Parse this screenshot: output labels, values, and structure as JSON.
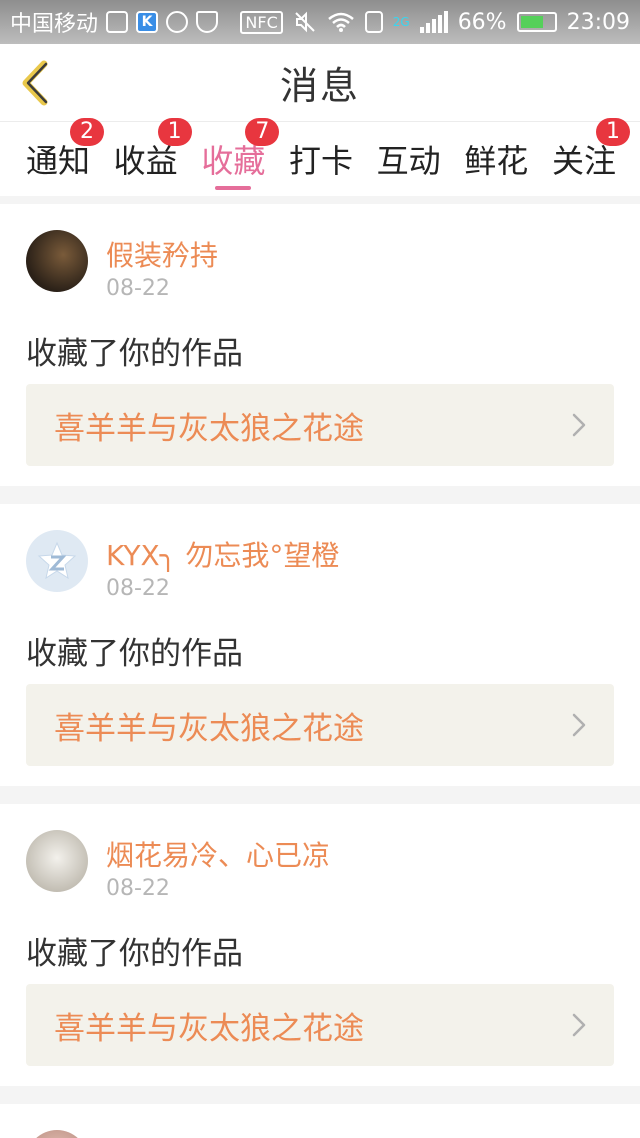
{
  "status_bar": {
    "carrier": "中国移动",
    "nfc": "NFC",
    "network": "2G",
    "battery": "66%",
    "time": "23:09"
  },
  "header": {
    "title": "消息"
  },
  "tabs": [
    {
      "label": "通知",
      "badge": "2"
    },
    {
      "label": "收益",
      "badge": "1"
    },
    {
      "label": "收藏",
      "badge": "7"
    },
    {
      "label": "打卡",
      "badge": ""
    },
    {
      "label": "互动",
      "badge": ""
    },
    {
      "label": "鲜花",
      "badge": ""
    },
    {
      "label": "关注",
      "badge": "1"
    }
  ],
  "active_tab": "收藏",
  "colors": {
    "accent": "#e56e9a",
    "username": "#ec8b55",
    "badge": "#e8363f"
  },
  "feed": [
    {
      "user": "假装矜持",
      "date": "08-22",
      "action": "收藏了你的作品",
      "work": "喜羊羊与灰太狼之花途"
    },
    {
      "user": "KYX╮ 勿忘我°望橙",
      "date": "08-22",
      "action": "收藏了你的作品",
      "work": "喜羊羊与灰太狼之花途"
    },
    {
      "user": "烟花易冷、心已凉",
      "date": "08-22",
      "action": "收藏了你的作品",
      "work": "喜羊羊与灰太狼之花途"
    }
  ]
}
